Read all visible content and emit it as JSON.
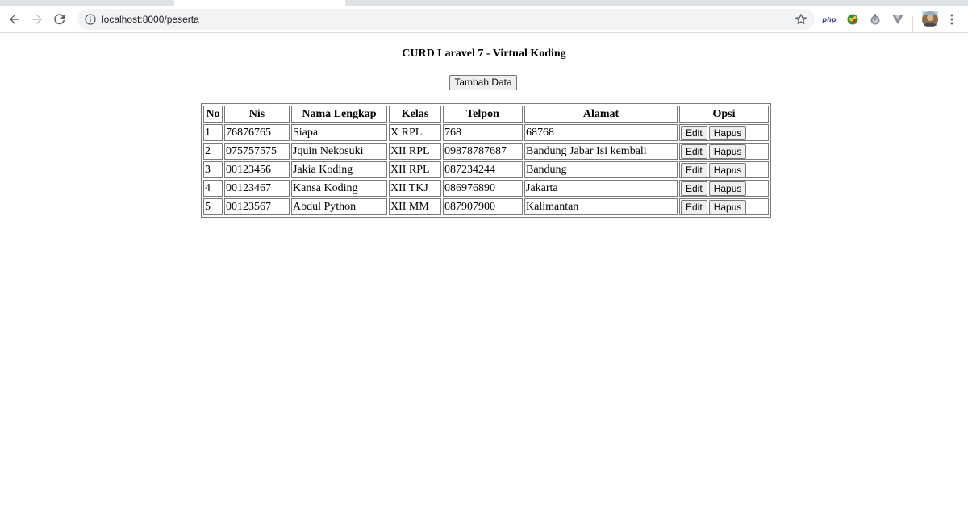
{
  "browser": {
    "url": "localhost:8000/peserta",
    "extensions": {
      "php_label": "php"
    },
    "colors": {
      "toolbar": "#ffffff",
      "omnibox": "#f1f3f4",
      "tabstrip": "#dee1e6"
    }
  },
  "page": {
    "title": "CURD Laravel 7 - Virtual Koding",
    "add_button": "Tambah Data"
  },
  "table": {
    "headers": [
      "No",
      "Nis",
      "Nama Lengkap",
      "Kelas",
      "Telpon",
      "Alamat",
      "Opsi"
    ],
    "rows": [
      {
        "no": "1",
        "nis": "76876765",
        "nama": "Siapa",
        "kelas": "X RPL",
        "telpon": "768",
        "alamat": "68768"
      },
      {
        "no": "2",
        "nis": "075757575",
        "nama": "Jquin Nekosuki",
        "kelas": "XII RPL",
        "telpon": "09878787687",
        "alamat": "Bandung Jabar Isi kembali"
      },
      {
        "no": "3",
        "nis": "00123456",
        "nama": "Jakia Koding",
        "kelas": "XII RPL",
        "telpon": "087234244",
        "alamat": "Bandung"
      },
      {
        "no": "4",
        "nis": "00123467",
        "nama": "Kansa Koding",
        "kelas": "XII TKJ",
        "telpon": "086976890",
        "alamat": "Jakarta"
      },
      {
        "no": "5",
        "nis": "00123567",
        "nama": "Abdul Python",
        "kelas": "XII MM",
        "telpon": "087907900",
        "alamat": "Kalimantan"
      }
    ],
    "edit_label": "Edit",
    "delete_label": "Hapus"
  }
}
